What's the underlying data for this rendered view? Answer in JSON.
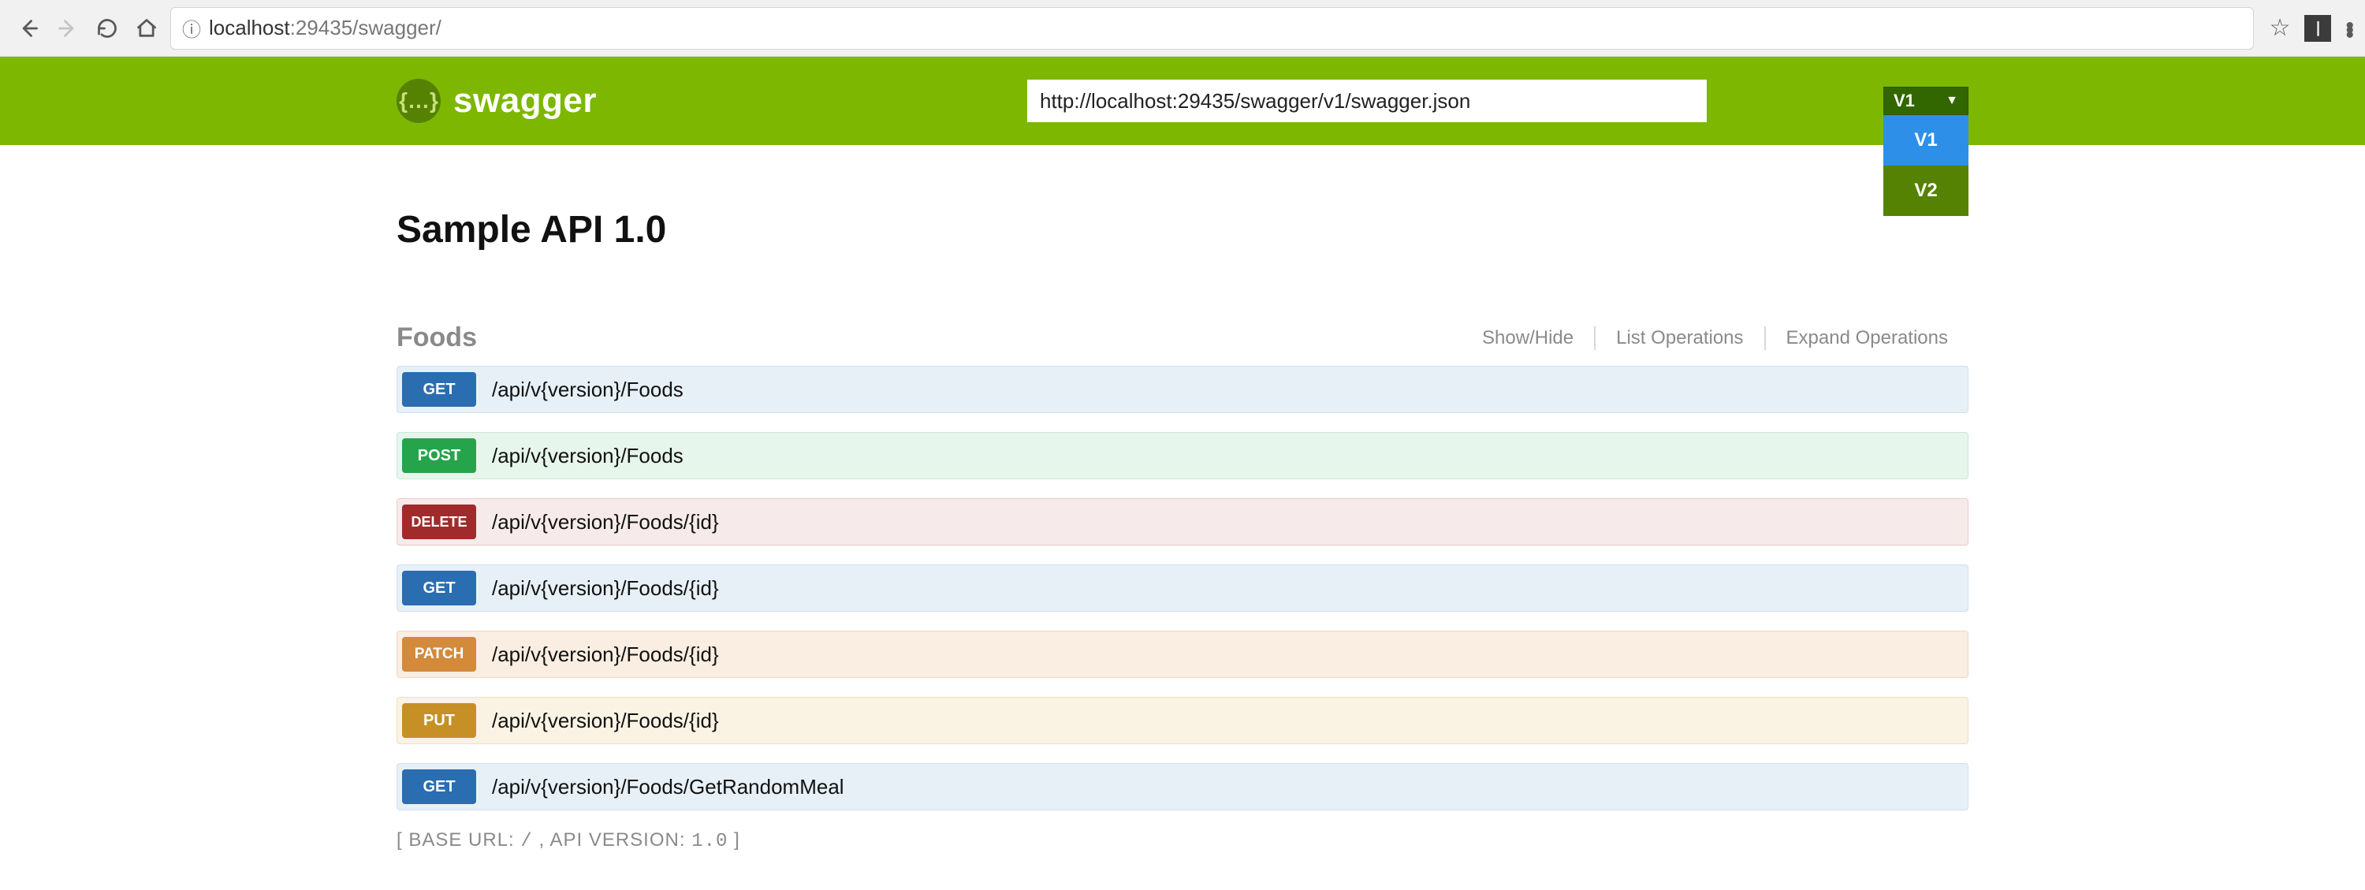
{
  "browser": {
    "url_display_host": "localhost",
    "url_display_port": ":29435",
    "url_display_path": "/swagger/"
  },
  "header": {
    "logo_text": "swagger",
    "json_url": "http://localhost:29435/swagger/v1/swagger.json",
    "version_selected": "V1",
    "version_options": [
      "V1",
      "V2"
    ]
  },
  "api": {
    "title": "Sample API 1.0"
  },
  "tag": {
    "name": "Foods",
    "actions": {
      "show_hide": "Show/Hide",
      "list_ops": "List Operations",
      "expand_ops": "Expand Operations"
    }
  },
  "endpoints": [
    {
      "method": "GET",
      "path": "/api/v{version}/Foods"
    },
    {
      "method": "POST",
      "path": "/api/v{version}/Foods"
    },
    {
      "method": "DELETE",
      "path": "/api/v{version}/Foods/{id}"
    },
    {
      "method": "GET",
      "path": "/api/v{version}/Foods/{id}"
    },
    {
      "method": "PATCH",
      "path": "/api/v{version}/Foods/{id}"
    },
    {
      "method": "PUT",
      "path": "/api/v{version}/Foods/{id}"
    },
    {
      "method": "GET",
      "path": "/api/v{version}/Foods/GetRandomMeal"
    }
  ],
  "footer": {
    "prefix": "[ BASE URL: ",
    "base_url": "/",
    "mid": " , API VERSION: ",
    "api_version": "1.0",
    "suffix": " ]"
  }
}
